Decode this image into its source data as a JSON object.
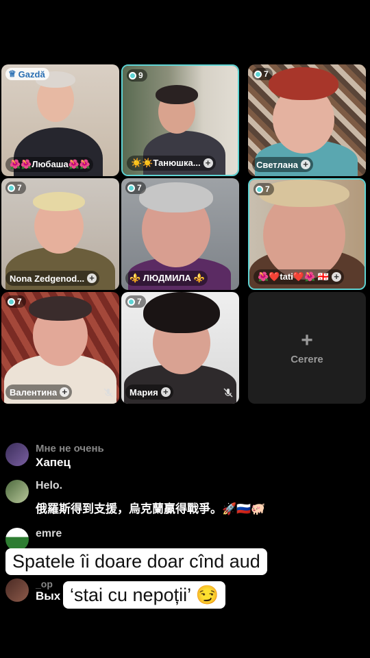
{
  "host_badge": "Gazdă",
  "tiles": [
    {
      "name": "🌺🌺Любаша🌺🌺"
    },
    {
      "count": "9",
      "name": "☀️☀️Танюшка..."
    },
    {
      "count": "7",
      "name": "Светлана"
    },
    {
      "count": "7",
      "name": "Nona Zedgenod..."
    },
    {
      "count": "7",
      "name": "⚜️ ЛЮДМИЛА ⚜️"
    },
    {
      "count": "7",
      "name": "🌺❤️tati❤️🌺 🇬🇪"
    },
    {
      "count": "7",
      "name": "Валентина"
    },
    {
      "count": "7",
      "name": "Мария"
    }
  ],
  "request_label": "Cerere",
  "chat": [
    {
      "user": "Мне не очень",
      "message": "Хапец"
    },
    {
      "user": "Helo.",
      "message": "俄羅斯得到支援，烏克蘭贏得戰爭。🚀🇷🇺🐖"
    },
    {
      "user": "emre",
      "message": ""
    },
    {
      "user": "_ор",
      "message": "Вых"
    }
  ],
  "caption": {
    "line1": "Spatele îi doare doar cînd aud",
    "line2": "‘stai cu nepoții’ 😏"
  },
  "colors": {
    "accent": "#5fd4d4",
    "host_text": "#2a6fb3",
    "background": "#000000"
  }
}
